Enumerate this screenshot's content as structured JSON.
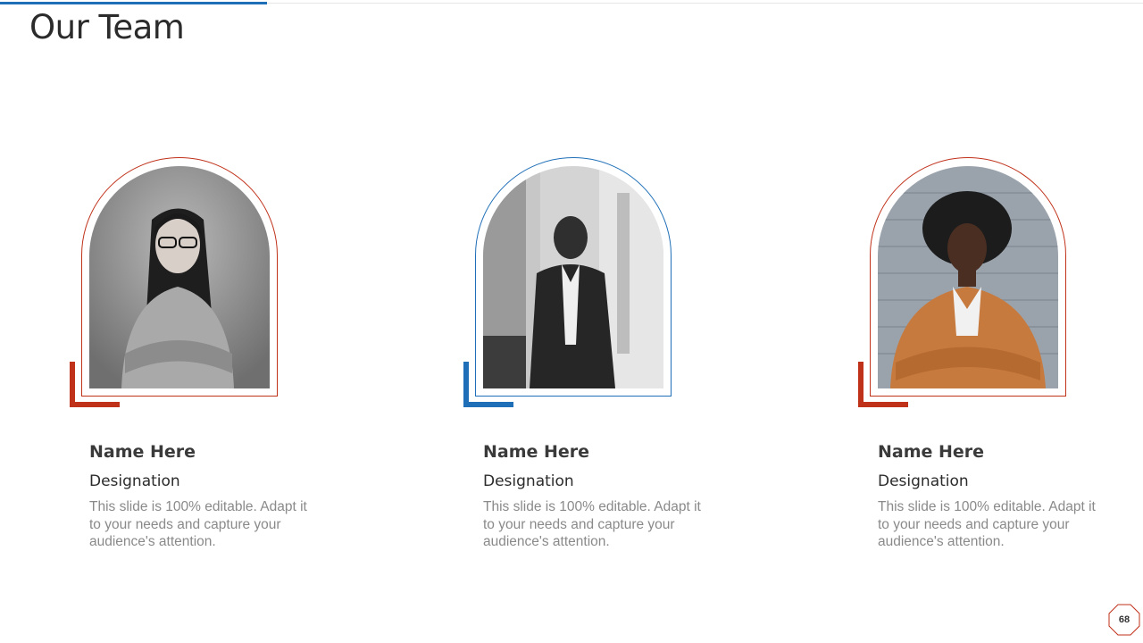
{
  "slide": {
    "title": "Our Team",
    "page_number": "68"
  },
  "colors": {
    "accent_blue": "#1f6fb8",
    "accent_red": "#c0311a"
  },
  "team": [
    {
      "name": "Name Here",
      "designation": "Designation",
      "description": "This slide is 100% editable. Adapt it to your needs and capture your audience's attention.",
      "accent": "red"
    },
    {
      "name": "Name Here",
      "designation": "Designation",
      "description": "This slide is 100% editable. Adapt it to your needs and capture your audience's attention.",
      "accent": "blue"
    },
    {
      "name": "Name Here",
      "designation": "Designation",
      "description": "This slide is 100% editable. Adapt it to your needs and capture your audience's attention.",
      "accent": "red"
    }
  ]
}
